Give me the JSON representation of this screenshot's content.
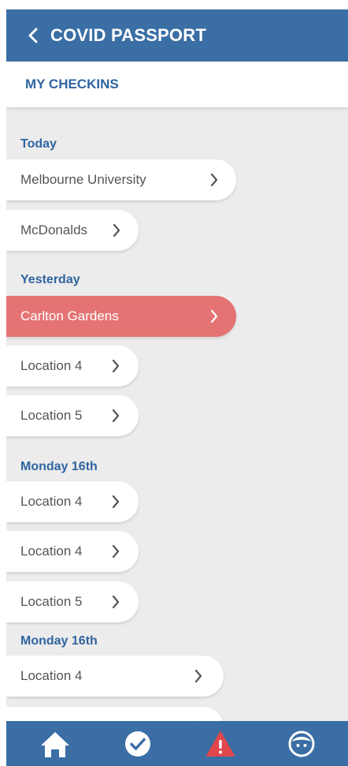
{
  "header": {
    "title": "COVID PASSPORT",
    "back_icon": "chevron-left-icon",
    "color": "#3a6ea5"
  },
  "subheader": {
    "title": "MY CHECKINS"
  },
  "sections": [
    {
      "label": "Today",
      "items": [
        {
          "label": "Melbourne University"
        },
        {
          "label": "McDonalds"
        }
      ]
    },
    {
      "label": "Yesterday",
      "items": [
        {
          "label": "Carlton Gardens",
          "alert": true
        },
        {
          "label": "Location 4"
        },
        {
          "label": "Location 5"
        }
      ]
    },
    {
      "label": "Monday 16th",
      "items": [
        {
          "label": "Location 4"
        },
        {
          "label": "Location 4"
        },
        {
          "label": "Location 5"
        }
      ]
    },
    {
      "label": "Monday 16th",
      "items": [
        {
          "label": "Location 4"
        },
        {
          "label": ""
        }
      ]
    }
  ],
  "colors": {
    "accent": "#3a6ea5",
    "section_label": "#2f64a0",
    "alert": "#e57373",
    "alert_icon": "#e0474c",
    "background": "#ececec"
  },
  "bottom_nav": [
    {
      "icon": "home-icon"
    },
    {
      "icon": "check-circle-icon"
    },
    {
      "icon": "warning-icon"
    },
    {
      "icon": "face-icon"
    }
  ]
}
